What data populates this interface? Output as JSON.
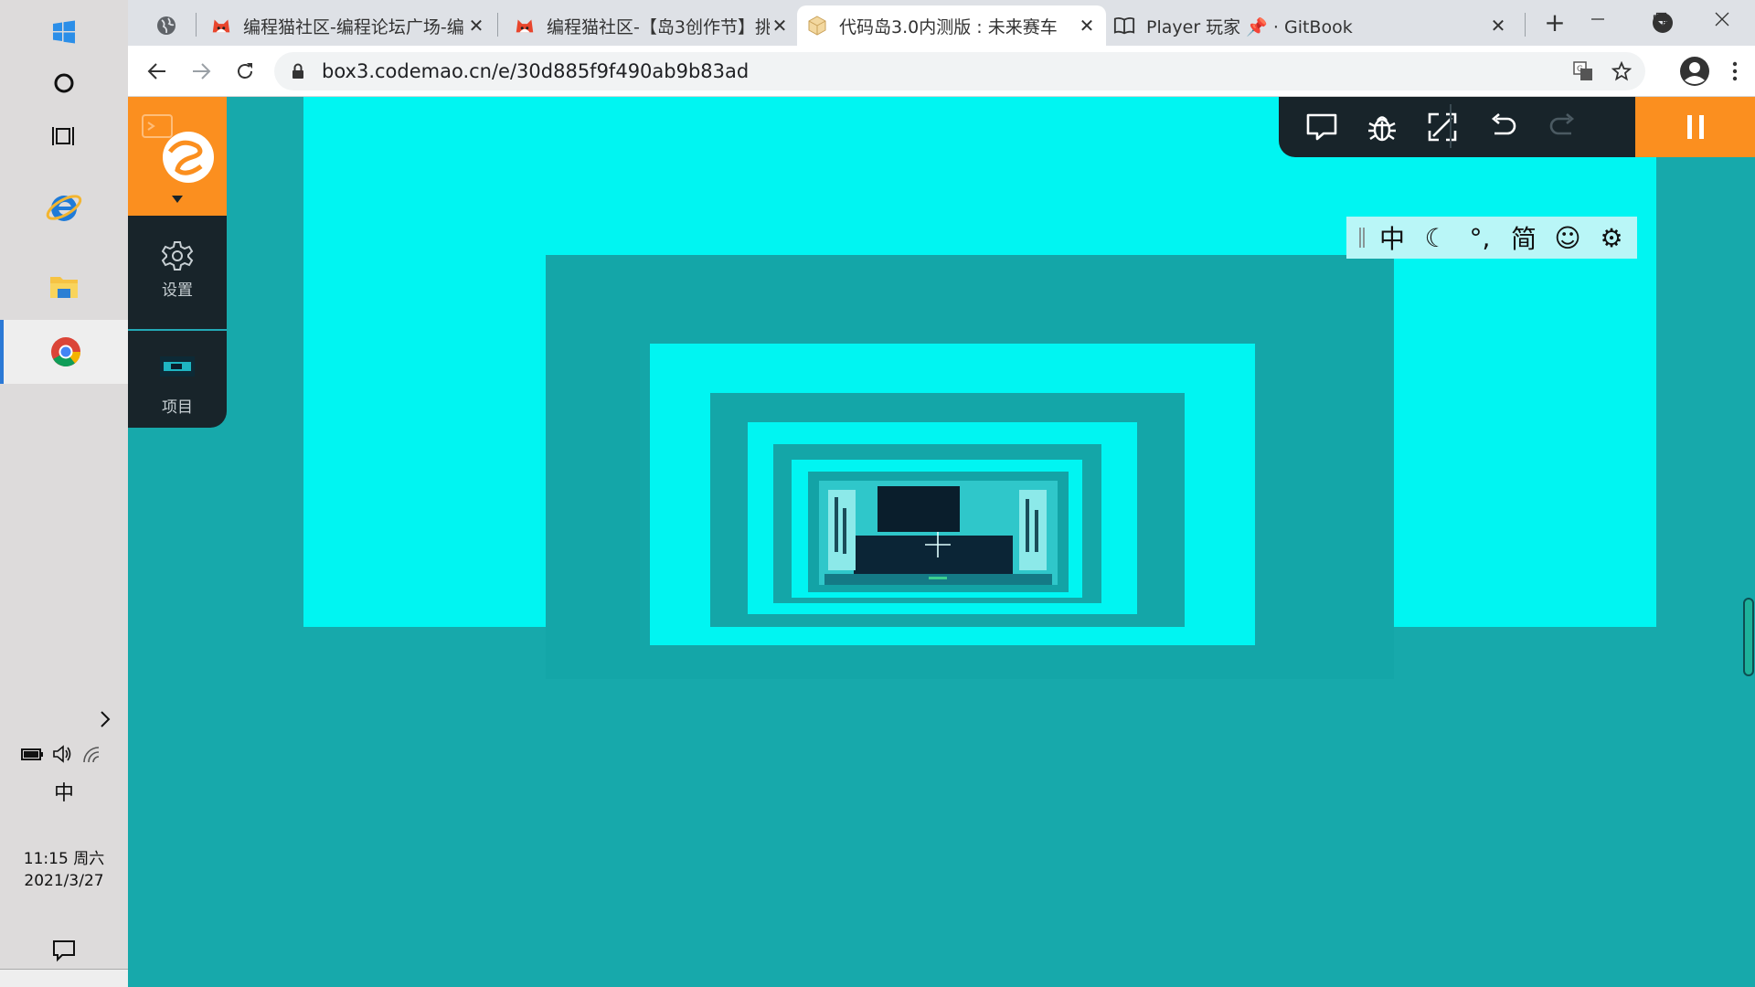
{
  "taskbar": {
    "clock_time": "11:15 周六",
    "clock_date": "2021/3/27",
    "ime_mode": "中"
  },
  "browser": {
    "tabs": [
      {
        "title": "",
        "icon": "globe-icon"
      },
      {
        "title": "编程猫社区-编程论坛广场-编",
        "icon": "codemao-cat-icon"
      },
      {
        "title": "编程猫社区-【岛3创作节】挑",
        "icon": "codemao-cat-icon"
      },
      {
        "title": "代码岛3.0内测版 : 未来赛车",
        "icon": "box3-cube-icon"
      },
      {
        "title": "Player 玩家 📌 · GitBook",
        "icon": "gitbook-icon"
      }
    ],
    "url": "box3.codemao.cn/e/30d885f9f490ab9b83ad"
  },
  "side_panel": {
    "settings_label": "设置",
    "project_label": "项目"
  },
  "ime_toolbar": {
    "items": [
      "中",
      "☾",
      "°,",
      "简",
      "☺",
      "⚙"
    ]
  },
  "colors": {
    "scene_teal": "#17a9ab",
    "scene_cyan": "#00f5f2",
    "accent_orange": "#fb8f1f",
    "panel_dark": "#18242a"
  }
}
